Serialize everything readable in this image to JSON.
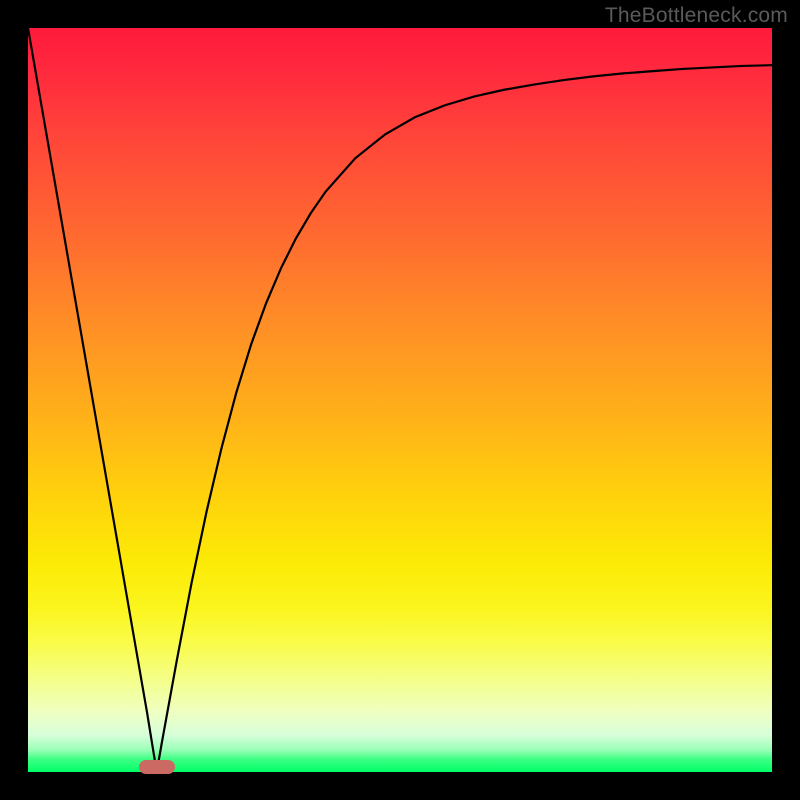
{
  "watermark": {
    "text": "TheBottleneck.com"
  },
  "chart_data": {
    "type": "line",
    "title": "",
    "xlabel": "",
    "ylabel": "",
    "xlim": [
      0,
      100
    ],
    "ylim": [
      0,
      100
    ],
    "x": [
      0,
      2,
      4,
      6,
      8,
      10,
      12,
      14,
      16,
      17.3,
      18,
      20,
      22,
      24,
      26,
      28,
      30,
      32,
      34,
      36,
      38,
      40,
      44,
      48,
      52,
      56,
      60,
      64,
      68,
      72,
      76,
      80,
      84,
      88,
      92,
      96,
      100
    ],
    "y": [
      100,
      88.5,
      77,
      65.5,
      54,
      42.5,
      31,
      19.5,
      8,
      0,
      4,
      15,
      25.5,
      35,
      43.5,
      51,
      57.5,
      63,
      67.7,
      71.7,
      75.1,
      78,
      82.5,
      85.7,
      88,
      89.6,
      90.8,
      91.7,
      92.4,
      93,
      93.5,
      93.9,
      94.2,
      94.5,
      94.7,
      94.9,
      95
    ],
    "legend": false,
    "grid": false,
    "marker": {
      "x": 17.3,
      "width_frac": 0.048,
      "color": "#cb6a62"
    },
    "background": "rainbow-vertical-gradient"
  }
}
